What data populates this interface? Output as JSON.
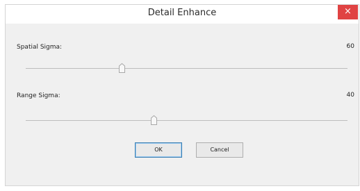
{
  "dialog": {
    "title": "Detail Enhance",
    "close_glyph": "×"
  },
  "spatial_sigma": {
    "label": "Spatial Sigma:",
    "value": "60",
    "level": 0.3
  },
  "range_sigma": {
    "label": "Range Sigma:",
    "value": "40",
    "level": 0.4
  },
  "buttons": {
    "ok": "OK",
    "cancel": "Cancel"
  },
  "colors": {
    "close_button": "#e04343",
    "default_button_border": "#3c7fb1"
  }
}
